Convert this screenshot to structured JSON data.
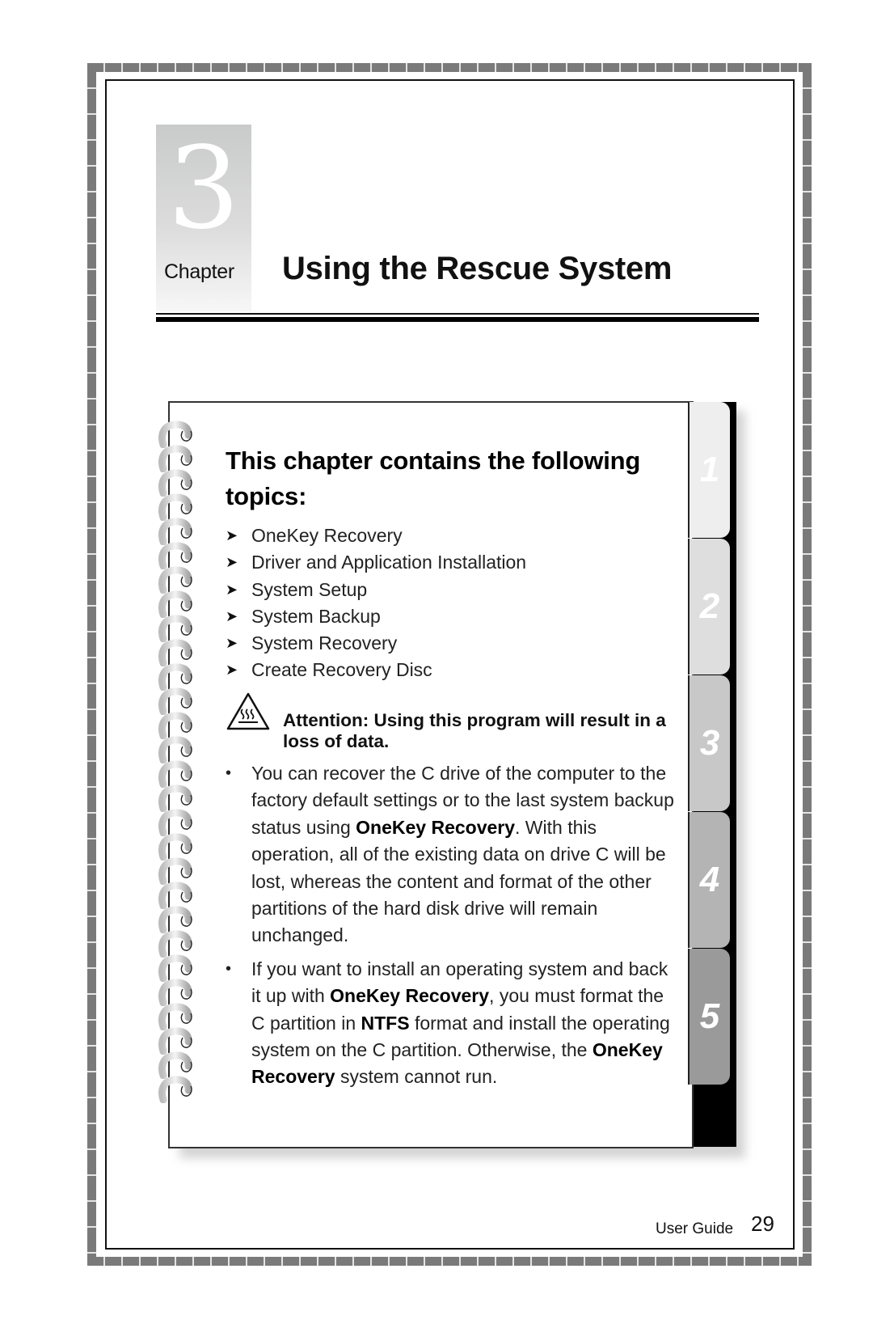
{
  "chapter": {
    "number": "3",
    "word": "Chapter",
    "title": "Using the Rescue System"
  },
  "card": {
    "heading": "This chapter contains the following topics:",
    "topics": [
      "OneKey Recovery",
      "Driver and Application Installation",
      "System Setup",
      "System Backup",
      "System Recovery",
      "Create Recovery Disc"
    ],
    "attention_icon": "hot-surface-warning-icon",
    "attention": "Attention: Using this program will result in a loss of data.",
    "bullets": [
      [
        {
          "t": "You can recover the C drive of the computer to the factory default settings or to the last system backup status using ",
          "b": false
        },
        {
          "t": "OneKey Recovery",
          "b": true
        },
        {
          "t": ". With this operation, all of the existing data on drive C will be lost, whereas the content and format of the other partitions of the hard disk drive will remain unchanged.",
          "b": false
        }
      ],
      [
        {
          "t": "If you want to install an operating system and back it up with ",
          "b": false
        },
        {
          "t": "OneKey Recovery",
          "b": true
        },
        {
          "t": ", you must format the C partition in ",
          "b": false
        },
        {
          "t": "NTFS",
          "b": true
        },
        {
          "t": " format and install the operating system on the C partition. Otherwise, the ",
          "b": false
        },
        {
          "t": "OneKey Recovery",
          "b": true
        },
        {
          "t": " system cannot run.",
          "b": false
        }
      ]
    ],
    "tabs": [
      {
        "label": "1",
        "color": "#eeeeee"
      },
      {
        "label": "2",
        "color": "#dedede"
      },
      {
        "label": "3",
        "color": "#c8c8c8"
      },
      {
        "label": "4",
        "color": "#b4b4b4"
      },
      {
        "label": "5",
        "color": "#9a9a9a",
        "active": true
      }
    ],
    "ring_count": 28
  },
  "footer": {
    "label": "User Guide",
    "page": "29"
  }
}
